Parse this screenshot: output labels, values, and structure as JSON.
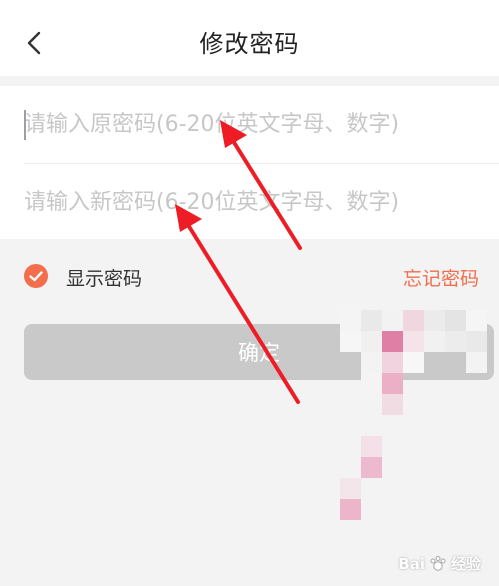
{
  "header": {
    "title": "修改密码",
    "back_icon": "chevron-left-icon"
  },
  "form": {
    "old_password": {
      "placeholder": "请输入原密码(6-20位英文字母、数字)",
      "value": ""
    },
    "new_password": {
      "placeholder": "请输入新密码(6-20位英文字母、数字)",
      "value": ""
    }
  },
  "options": {
    "show_password_label": "显示密码",
    "show_password_checked": true,
    "forgot_label": "忘记密码"
  },
  "confirm_label": "确定",
  "watermark": {
    "left_text": "Bai",
    "right_text": "经验"
  },
  "colors": {
    "accent": "#f26e4c",
    "button_disabled": "#c9c9c9",
    "annotation_arrow": "#ee1c25",
    "background": "#f3f3f3"
  }
}
